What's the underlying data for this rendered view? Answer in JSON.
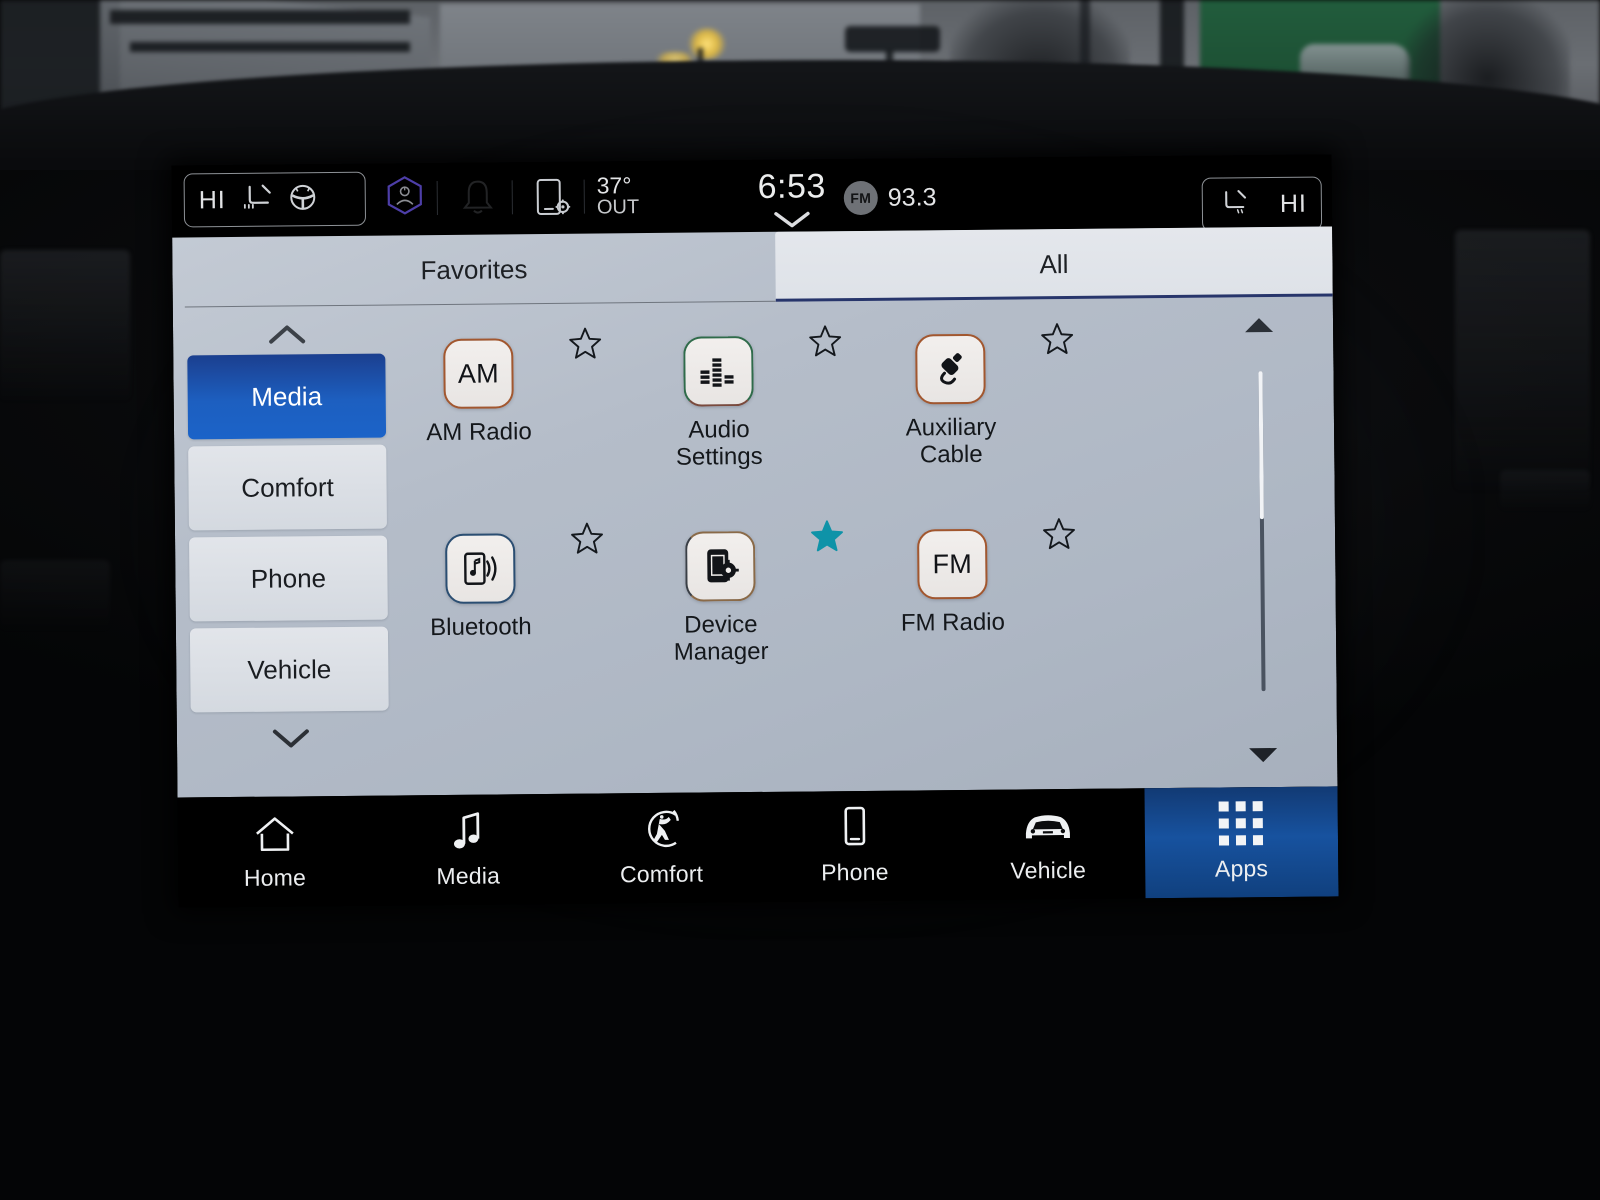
{
  "status_bar": {
    "left_climate": {
      "level": "HI",
      "icons": [
        "heated-seat-icon",
        "heated-steering-wheel-icon"
      ]
    },
    "right_climate": {
      "level": "HI",
      "icons": [
        "heated-seat-icon"
      ]
    },
    "profile_icon": "driver-profile-icon",
    "notification_icon": "bell-icon",
    "phone_settings_icon": "phone-settings-icon",
    "temperature": {
      "value": "37°",
      "label": "OUT"
    },
    "clock": {
      "time": "6:53",
      "expand_icon": "chevron-down-icon"
    },
    "radio": {
      "band": "FM",
      "frequency": "93.3"
    }
  },
  "tabs": [
    {
      "label": "Favorites",
      "selected": false
    },
    {
      "label": "All",
      "selected": true
    }
  ],
  "sidebar": {
    "scroll_up_icon": "chevron-up-icon",
    "scroll_down_icon": "chevron-down-icon",
    "items": [
      {
        "label": "Media",
        "selected": true
      },
      {
        "label": "Comfort",
        "selected": false
      },
      {
        "label": "Phone",
        "selected": false
      },
      {
        "label": "Vehicle",
        "selected": false
      }
    ]
  },
  "apps": [
    {
      "name": "AM Radio",
      "icon": "am-radio-icon",
      "glyph": "AM",
      "favorited": false,
      "border": "orange"
    },
    {
      "name": "Audio Settings",
      "icon": "equalizer-icon",
      "glyph": "",
      "favorited": false,
      "border": "green"
    },
    {
      "name": "Auxiliary Cable",
      "icon": "aux-cable-icon",
      "glyph": "",
      "favorited": false,
      "border": "orange"
    },
    {
      "name": "Bluetooth",
      "icon": "bluetooth-audio-icon",
      "glyph": "",
      "favorited": false,
      "border": "blue"
    },
    {
      "name": "Device Manager",
      "icon": "device-manager-icon",
      "glyph": "",
      "favorited": true,
      "border": "tan"
    },
    {
      "name": "FM Radio",
      "icon": "fm-radio-icon",
      "glyph": "FM",
      "favorited": false,
      "border": "orange"
    }
  ],
  "scrollbar": {
    "up_icon": "triangle-up-icon",
    "down_icon": "triangle-down-icon",
    "thumb_position_percent": 0,
    "thumb_size_percent": 46
  },
  "bottom_nav": [
    {
      "label": "Home",
      "icon": "home-icon",
      "active": false
    },
    {
      "label": "Media",
      "icon": "music-note-icon",
      "active": false
    },
    {
      "label": "Comfort",
      "icon": "comfort-seat-icon",
      "active": false
    },
    {
      "label": "Phone",
      "icon": "phone-icon",
      "active": false
    },
    {
      "label": "Vehicle",
      "icon": "car-icon",
      "active": false
    },
    {
      "label": "Apps",
      "icon": "apps-grid-icon",
      "active": true
    }
  ],
  "colors": {
    "accent_blue": "#1d5fc0",
    "nav_active_blue": "#17529f",
    "favorite_star": "#0e93a8",
    "tab_underline": "#27356b",
    "panel_bg": "#b5bdc9"
  }
}
